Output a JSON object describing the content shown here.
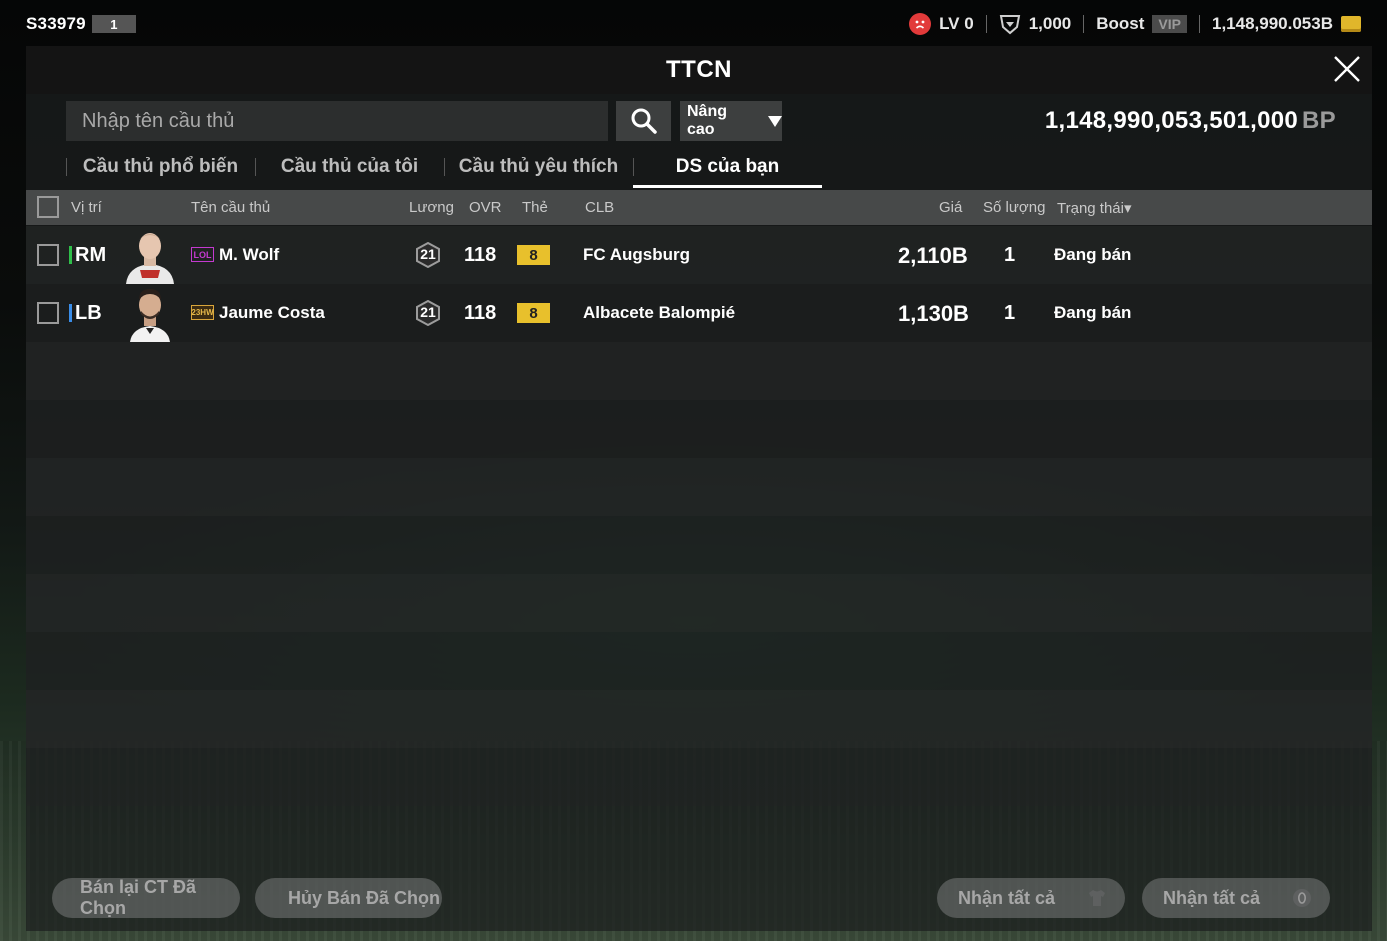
{
  "topbar": {
    "server": "S33979",
    "server_badge": "1",
    "level": "LV 0",
    "shield_value": "1,000",
    "boost_label": "Boost",
    "vip_label": "VIP",
    "currency_value": "1,148,990.053B"
  },
  "panel": {
    "title": "TTCN"
  },
  "search": {
    "placeholder": "Nhập tên cầu thủ",
    "advanced_label": "Nâng cao"
  },
  "balance": {
    "value": "1,148,990,053,501,000",
    "unit": "BP"
  },
  "tabs": [
    {
      "label": "Cầu thủ phổ biến"
    },
    {
      "label": "Cầu thủ của tôi"
    },
    {
      "label": "Cầu thủ yêu thích"
    },
    {
      "label": "DS của bạn"
    }
  ],
  "table": {
    "headers": {
      "position": "Vị trí",
      "name": "Tên cầu thủ",
      "salary": "Lương",
      "ovr": "OVR",
      "card": "Thẻ",
      "club": "CLB",
      "price": "Giá",
      "quantity": "Số lượng",
      "status": "Trạng thái▾"
    },
    "rows": [
      {
        "position": "RM",
        "position_color": "#2fbf4a",
        "season": "LOL",
        "season_color": "#c43ad0",
        "name": "M. Wolf",
        "salary": "21",
        "ovr": "118",
        "card": "8",
        "club": "FC Augsburg",
        "price": "2,110B",
        "quantity": "1",
        "status": "Đang bán"
      },
      {
        "position": "LB",
        "position_color": "#3a8de8",
        "season": "23HW",
        "season_color": "#d9a53a",
        "name": "Jaume Costa",
        "salary": "21",
        "ovr": "118",
        "card": "8",
        "club": "Albacete Balompié",
        "price": "1,130B",
        "quantity": "1",
        "status": "Đang bán"
      }
    ]
  },
  "footer": {
    "resell_label": "Bán lại CT Đã Chọn",
    "cancel_label": "Hủy Bán Đã Chọn",
    "receive_all_players_label": "Nhận tất cả",
    "receive_all_bp_label": "Nhận tất cả"
  }
}
